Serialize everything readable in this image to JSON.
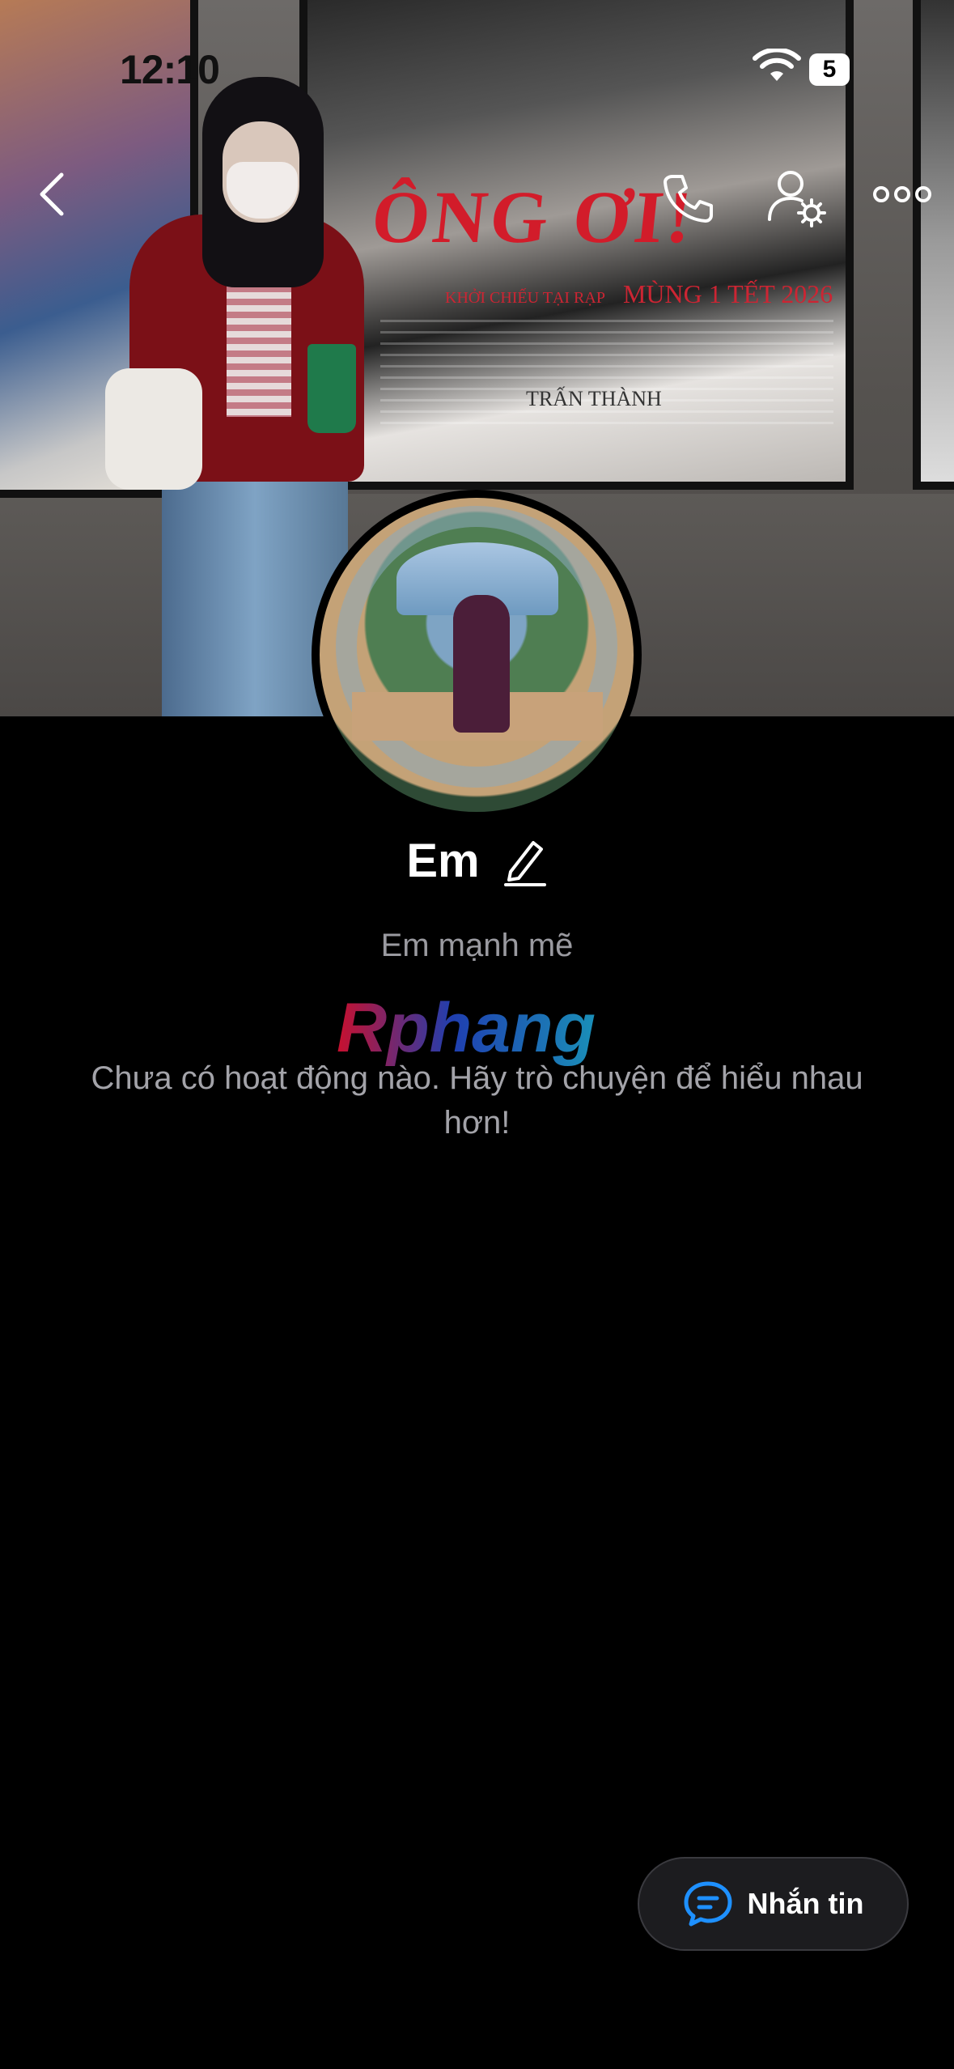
{
  "status_bar": {
    "time": "12:10",
    "battery": "5"
  },
  "cover": {
    "poster_title": "ÔNG ƠI!",
    "poster_subtitle": "MÙNG 1 TẾT 2026",
    "poster_tagline": "KHỞI CHIẾU TẠI RẠP",
    "poster_credit": "TRẤN THÀNH"
  },
  "profile": {
    "name": "Em",
    "bio": "Em mạnh mẽ",
    "watermark": "Rphang",
    "empty_message": "Chưa có hoạt động nào. Hãy trò chuyện để hiểu nhau hơn!"
  },
  "actions": {
    "message_label": "Nhắn tin"
  },
  "icons": {
    "back": "chevron-left-icon",
    "call": "phone-icon",
    "settings": "user-settings-icon",
    "more": "more-icon",
    "edit": "pencil-icon",
    "message": "chat-bubble-icon"
  },
  "colors": {
    "background": "#000000",
    "accent": "#1e90ff",
    "text_secondary": "#9a9aa0"
  }
}
